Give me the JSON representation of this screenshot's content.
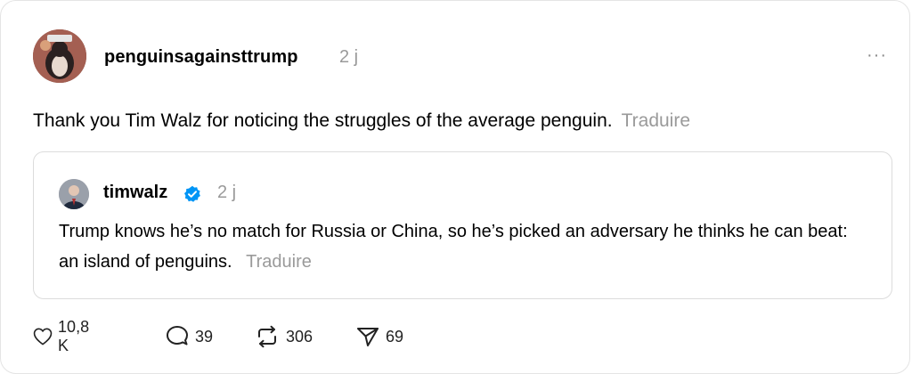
{
  "post": {
    "username": "penguinsagainsttrump",
    "time": "2 j",
    "more_label": "···",
    "text": "Thank you Tim Walz for noticing the struggles of the average penguin.",
    "translate_label": "Traduire"
  },
  "quote": {
    "username": "timwalz",
    "verified": true,
    "time": "2 j",
    "text": "Trump knows he’s no match for Russia or China, so he’s picked an adversary he thinks he can beat: an island of penguins.",
    "translate_label": "Traduire"
  },
  "actions": {
    "likes": "10,8 K",
    "replies": "39",
    "reposts": "306",
    "shares": "69"
  },
  "colors": {
    "muted_text": "#9a9a9a",
    "verified_blue": "#0095f6",
    "border": "#dcdcdc"
  },
  "icons": [
    "heart-icon",
    "comment-icon",
    "repost-icon",
    "share-icon",
    "verified-icon",
    "more-icon"
  ]
}
